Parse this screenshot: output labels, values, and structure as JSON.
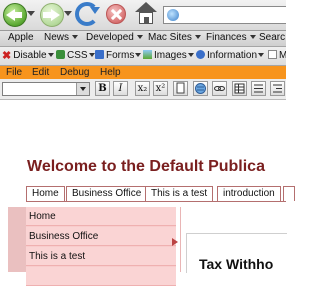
{
  "browser": {
    "nav_buttons": [
      "back",
      "forward",
      "reload",
      "stop",
      "home"
    ],
    "url": ""
  },
  "bookmarks": [
    {
      "label": "Apple",
      "has_menu": false
    },
    {
      "label": "News",
      "has_menu": true
    },
    {
      "label": "Developed",
      "has_menu": true
    },
    {
      "label": "Mac Sites",
      "has_menu": true
    },
    {
      "label": "Finances",
      "has_menu": true
    },
    {
      "label": "Searc",
      "has_menu": false
    }
  ],
  "webdev_toolbar": [
    {
      "label": "Disable",
      "icon": "disable-icon",
      "color": "#cc2222"
    },
    {
      "label": "CSS",
      "icon": "css-icon",
      "color": "#3a8f3a"
    },
    {
      "label": "Forms",
      "icon": "forms-icon",
      "color": "#3a6fc9"
    },
    {
      "label": "Images",
      "icon": "images-icon",
      "color": "#3a8f3a"
    },
    {
      "label": "Information",
      "icon": "information-icon",
      "color": "#3a6fc9"
    },
    {
      "label": "Mi",
      "icon": "misc-icon",
      "color": "#888888"
    }
  ],
  "editor": {
    "menu": [
      "File",
      "Edit",
      "Debug",
      "Help"
    ],
    "format_select_value": "",
    "buttons": [
      "B",
      "I",
      "x₂",
      "x²"
    ],
    "menubar_color": "#f7941d"
  },
  "page": {
    "title": "Welcome to the Default Publica",
    "tabs": [
      "Home",
      "Business Office",
      "This is a test",
      "introduction",
      ""
    ],
    "sidebar": [
      "Home",
      "Business Office",
      "This is a test"
    ],
    "content_heading": "Tax Withho",
    "accent_color": "#7a1f1f"
  }
}
